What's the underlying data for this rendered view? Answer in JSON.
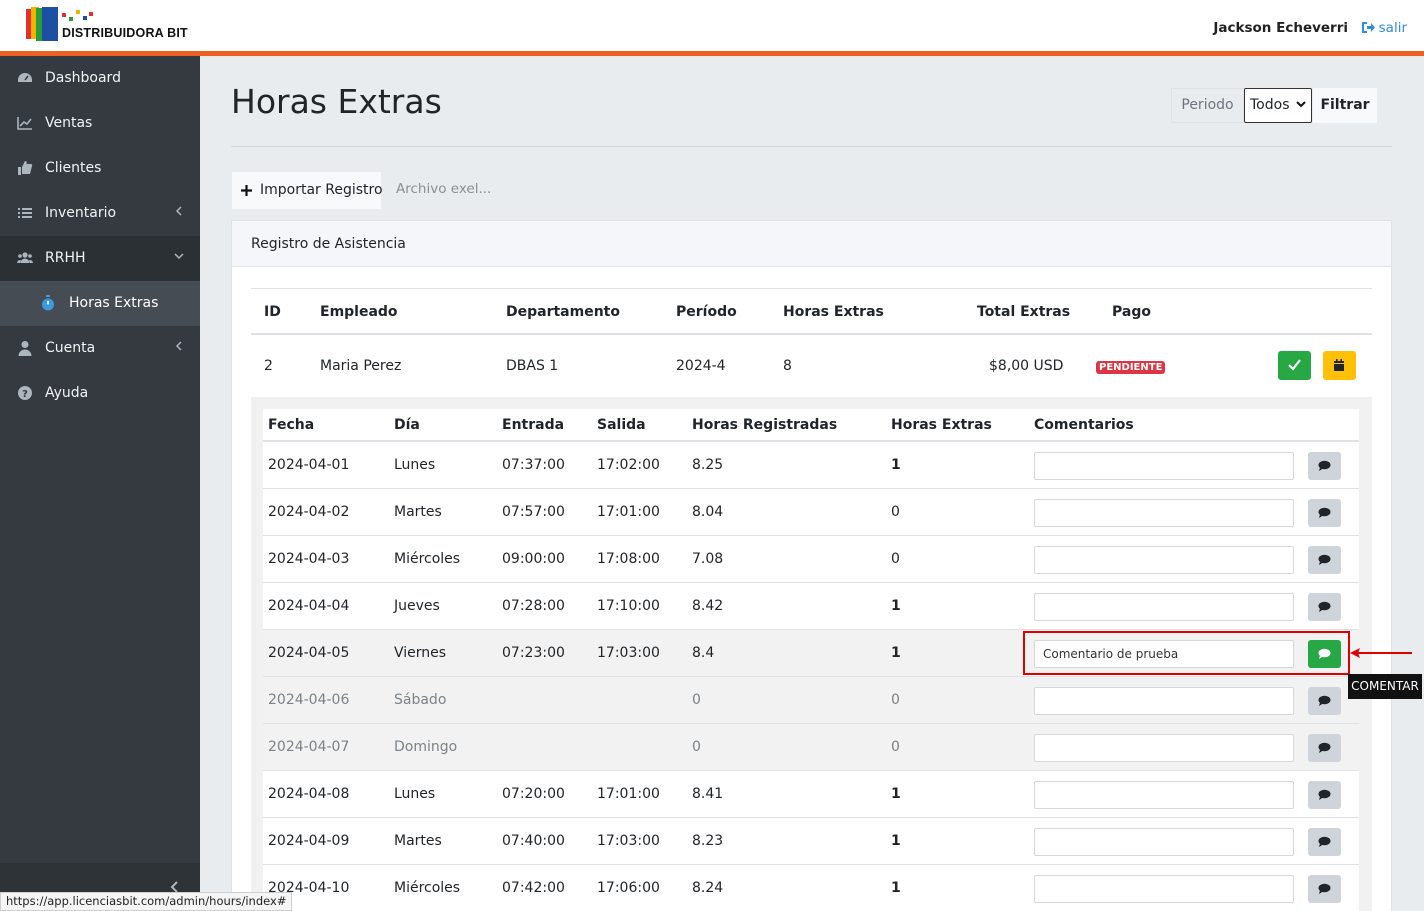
{
  "app": {
    "logo_text": "DISTRIBUIDORA BIT",
    "user_name": "Jackson Echeverri",
    "logout_label": "salir",
    "brand_color": "#f06022"
  },
  "sidebar": {
    "items": [
      {
        "label": "Dashboard",
        "icon": "dashboard-icon"
      },
      {
        "label": "Ventas",
        "icon": "chart-line-icon"
      },
      {
        "label": "Clientes",
        "icon": "thumbs-up-icon"
      },
      {
        "label": "Inventario",
        "icon": "list-icon"
      },
      {
        "label": "RRHH",
        "icon": "users-icon"
      },
      {
        "label": "Cuenta",
        "icon": "user-icon"
      },
      {
        "label": "Ayuda",
        "icon": "question-icon"
      }
    ],
    "sub_item": {
      "label": "Horas Extras",
      "icon": "stopwatch-icon"
    }
  },
  "page": {
    "title": "Horas Extras",
    "periodo_label": "Periodo",
    "periodo_value": "Todos",
    "filter_button": "Filtrar",
    "import_button": "Importar Registros",
    "file_placeholder": "Archivo exel...",
    "card_title": "Registro de Asistencia"
  },
  "main_table": {
    "headers": [
      "ID",
      "Empleado",
      "Departamento",
      "Período",
      "Horas Extras",
      "Total Extras",
      "Pago"
    ],
    "row": {
      "id": "2",
      "empleado": "Maria Perez",
      "departamento": "DBAS 1",
      "periodo": "2024-4",
      "horas_extras": "8",
      "total_extras": "$8,00 USD",
      "pago": "PENDIENTE"
    }
  },
  "detail_table": {
    "headers": [
      "Fecha",
      "Día",
      "Entrada",
      "Salida",
      "Horas Registradas",
      "Horas Extras",
      "Comentarios"
    ],
    "rows": [
      {
        "fecha": "2024-04-01",
        "dia": "Lunes",
        "entrada": "07:37:00",
        "salida": "17:02:00",
        "registradas": "8.25",
        "extras": "1",
        "comentario": ""
      },
      {
        "fecha": "2024-04-02",
        "dia": "Martes",
        "entrada": "07:57:00",
        "salida": "17:01:00",
        "registradas": "8.04",
        "extras": "0",
        "comentario": ""
      },
      {
        "fecha": "2024-04-03",
        "dia": "Miércoles",
        "entrada": "09:00:00",
        "salida": "17:08:00",
        "registradas": "7.08",
        "extras": "0",
        "comentario": ""
      },
      {
        "fecha": "2024-04-04",
        "dia": "Jueves",
        "entrada": "07:28:00",
        "salida": "17:10:00",
        "registradas": "8.42",
        "extras": "1",
        "comentario": ""
      },
      {
        "fecha": "2024-04-05",
        "dia": "Viernes",
        "entrada": "07:23:00",
        "salida": "17:03:00",
        "registradas": "8.4",
        "extras": "1",
        "comentario": "Comentario de prueba"
      },
      {
        "fecha": "2024-04-06",
        "dia": "Sábado",
        "entrada": "",
        "salida": "",
        "registradas": "0",
        "extras": "0",
        "comentario": ""
      },
      {
        "fecha": "2024-04-07",
        "dia": "Domingo",
        "entrada": "",
        "salida": "",
        "registradas": "0",
        "extras": "0",
        "comentario": ""
      },
      {
        "fecha": "2024-04-08",
        "dia": "Lunes",
        "entrada": "07:20:00",
        "salida": "17:01:00",
        "registradas": "8.41",
        "extras": "1",
        "comentario": ""
      },
      {
        "fecha": "2024-04-09",
        "dia": "Martes",
        "entrada": "07:40:00",
        "salida": "17:03:00",
        "registradas": "8.23",
        "extras": "1",
        "comentario": ""
      },
      {
        "fecha": "2024-04-10",
        "dia": "Miércoles",
        "entrada": "07:42:00",
        "salida": "17:06:00",
        "registradas": "8.24",
        "extras": "1",
        "comentario": ""
      }
    ]
  },
  "tooltip": "COMENTAR",
  "status_url": "https://app.licenciasbit.com/admin/hours/index#"
}
